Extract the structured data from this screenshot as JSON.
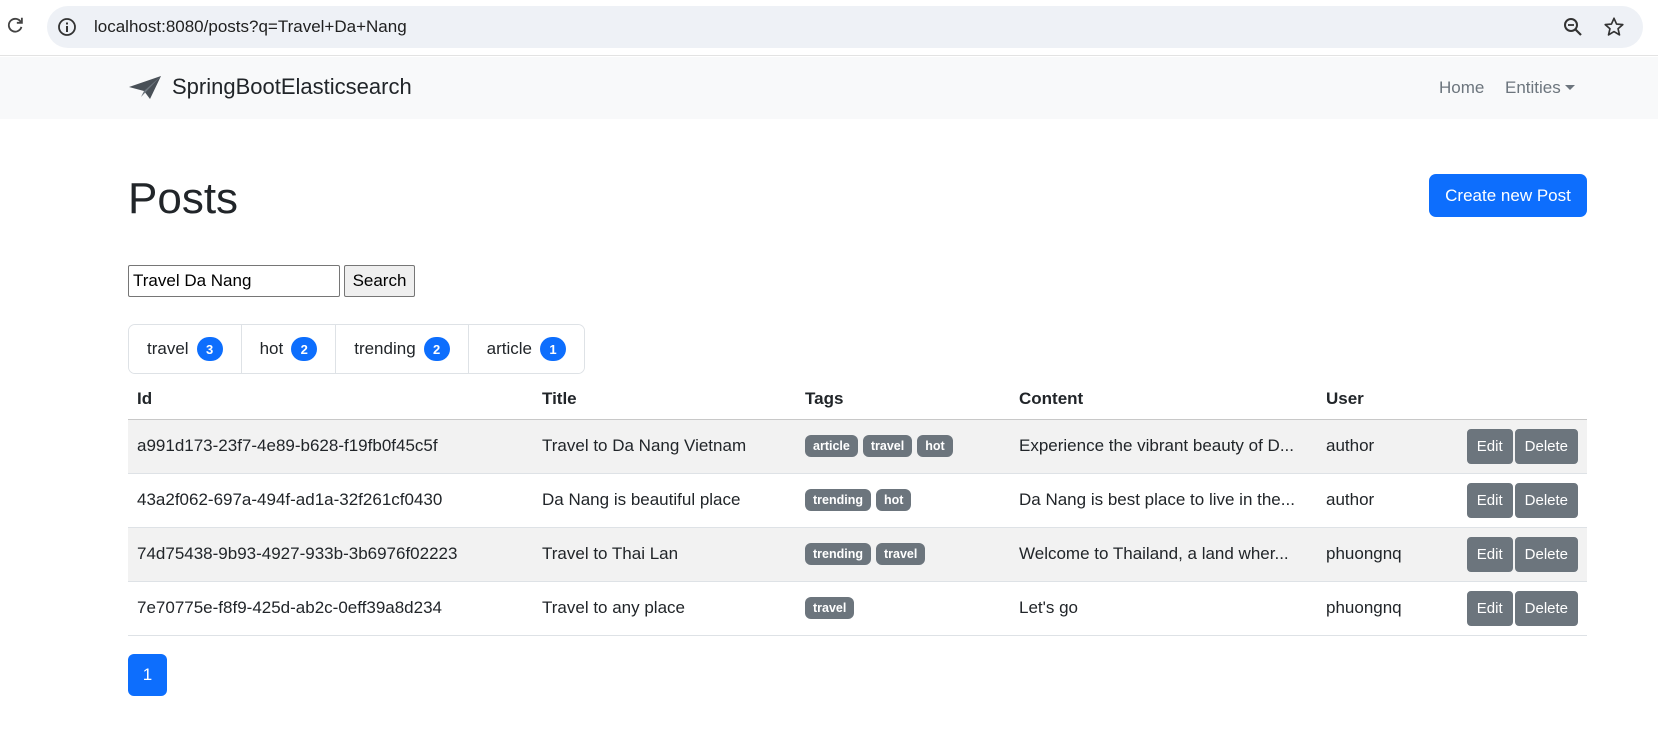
{
  "browser": {
    "url": "localhost:8080/posts?q=Travel+Da+Nang"
  },
  "navbar": {
    "brand": "SpringBootElasticsearch",
    "home_label": "Home",
    "entities_label": "Entities"
  },
  "page": {
    "title": "Posts",
    "create_label": "Create new Post"
  },
  "search": {
    "value": "Travel Da Nang",
    "button_label": "Search"
  },
  "tag_filters": [
    {
      "label": "travel",
      "count": "3"
    },
    {
      "label": "hot",
      "count": "2"
    },
    {
      "label": "trending",
      "count": "2"
    },
    {
      "label": "article",
      "count": "1"
    }
  ],
  "table": {
    "headers": {
      "id": "Id",
      "title": "Title",
      "tags": "Tags",
      "content": "Content",
      "user": "User"
    },
    "rows": [
      {
        "id": "a991d173-23f7-4e89-b628-f19fb0f45c5f",
        "title": "Travel to Da Nang Vietnam",
        "tags": [
          "article",
          "travel",
          "hot"
        ],
        "content": "Experience the vibrant beauty of D...",
        "user": "author",
        "edit": "Edit",
        "delete": "Delete"
      },
      {
        "id": "43a2f062-697a-494f-ad1a-32f261cf0430",
        "title": "Da Nang is beautiful place",
        "tags": [
          "trending",
          "hot"
        ],
        "content": "Da Nang is best place to live in the...",
        "user": "author",
        "edit": "Edit",
        "delete": "Delete"
      },
      {
        "id": "74d75438-9b93-4927-933b-3b6976f02223",
        "title": "Travel to Thai Lan",
        "tags": [
          "trending",
          "travel"
        ],
        "content": "Welcome to Thailand, a land wher...",
        "user": "phuongnq",
        "edit": "Edit",
        "delete": "Delete"
      },
      {
        "id": "7e70775e-f8f9-425d-ab2c-0eff39a8d234",
        "title": "Travel to any place",
        "tags": [
          "travel"
        ],
        "content": "Let's go",
        "user": "phuongnq",
        "edit": "Edit",
        "delete": "Delete"
      }
    ]
  },
  "pagination": {
    "current": "1"
  },
  "colors": {
    "primary": "#0d6efd",
    "secondary": "#6c757d",
    "navbar_bg": "#f8f9fa"
  },
  "icons": {
    "reload": "reload-icon",
    "info": "info-icon",
    "zoom": "zoom-icon",
    "star": "star-icon",
    "brand": "paper-plane-icon"
  }
}
